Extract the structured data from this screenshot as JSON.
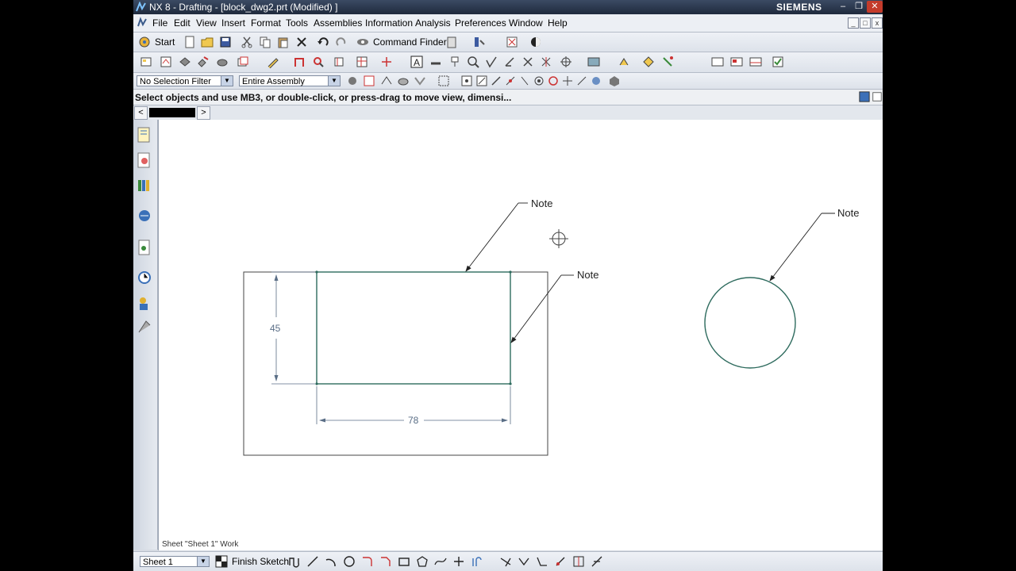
{
  "titlebar": {
    "title": "NX 8 - Drafting - [block_dwg2.prt (Modified) ]",
    "brand": "SIEMENS",
    "min": "–",
    "max": "❐",
    "close": "✕"
  },
  "menubar": {
    "items": [
      "File",
      "Edit",
      "View",
      "Insert",
      "Format",
      "Tools",
      "Assemblies",
      "Information",
      "Analysis",
      "Preferences",
      "Window",
      "Help"
    ]
  },
  "toolbar1": {
    "start_label": "Start",
    "command_finder_label": "Command Finder"
  },
  "selection": {
    "filter_value": "No Selection Filter",
    "scope_value": "Entire Assembly"
  },
  "status": {
    "message": "Select objects and use MB3, or double-click, or press-drag to move view, dimensi..."
  },
  "tabs": {
    "prev": "<",
    "next": ">"
  },
  "drawing": {
    "dim_vertical": "45",
    "dim_horizontal": "78",
    "note1": "Note",
    "note2": "Note",
    "note3": "Note",
    "sheet_caption": "Sheet \"Sheet 1\" Work",
    "geometry_color": "#2e6b5e",
    "dimension_color": "#5a6e86"
  },
  "bottombar": {
    "sheet_value": "Sheet 1",
    "finish_sketch_label": "Finish Sketch"
  },
  "colors": {
    "titlebar": "#1f2a3d",
    "close_button": "#c43b2b",
    "canvas": "#ffffff"
  }
}
